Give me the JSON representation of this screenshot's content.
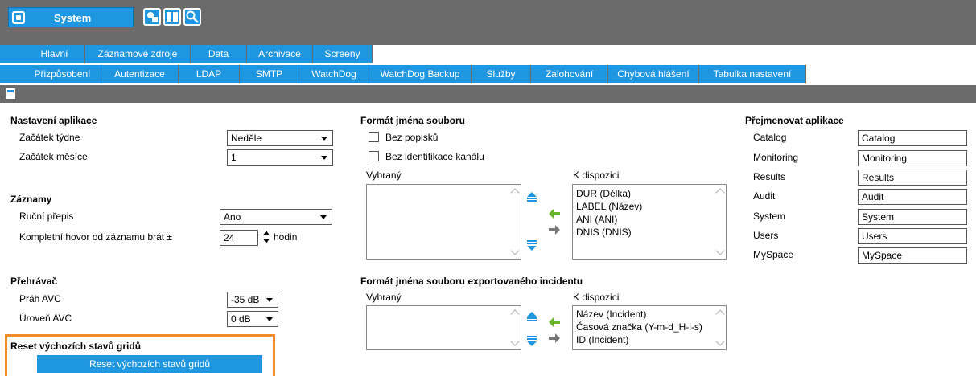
{
  "app": {
    "title": "System"
  },
  "tabs_primary": [
    {
      "label": "Hlavní"
    },
    {
      "label": "Záznamové zdroje"
    },
    {
      "label": "Data"
    },
    {
      "label": "Archivace"
    },
    {
      "label": "Screeny"
    }
  ],
  "tabs_secondary": [
    {
      "label": "Přizpůsobení"
    },
    {
      "label": "Autentizace"
    },
    {
      "label": "LDAP"
    },
    {
      "label": "SMTP"
    },
    {
      "label": "WatchDog"
    },
    {
      "label": "WatchDog Backup"
    },
    {
      "label": "Služby"
    },
    {
      "label": "Zálohování"
    },
    {
      "label": "Chybová hlášení"
    },
    {
      "label": "Tabulka nastavení"
    }
  ],
  "app_settings": {
    "heading": "Nastavení aplikace",
    "week_start_label": "Začátek týdne",
    "week_start_value": "Neděle",
    "month_start_label": "Začátek měsíce",
    "month_start_value": "1"
  },
  "records": {
    "heading": "Záznamy",
    "manual_label": "Ruční přepis",
    "manual_value": "Ano",
    "full_call_label": "Kompletní hovor od záznamu brát ±",
    "full_call_value": "24",
    "full_call_unit": "hodin"
  },
  "player": {
    "heading": "Přehrávač",
    "avc_threshold_label": "Práh AVC",
    "avc_threshold_value": "-35 dB",
    "avc_level_label": "Úroveň AVC",
    "avc_level_value": "0 dB"
  },
  "reset": {
    "heading": "Reset výchozích stavů gridů",
    "button": "Reset výchozích stavů gridů"
  },
  "filename_format": {
    "heading": "Formát jména souboru",
    "no_labels": "Bez popisků",
    "no_channel": "Bez identifikace kanálu",
    "selected_label": "Vybraný",
    "available_label": "K dispozici",
    "available": [
      "DUR (Délka)",
      "LABEL (Název)",
      "ANI (ANI)",
      "DNIS (DNIS)"
    ]
  },
  "incident_format": {
    "heading": "Formát jména souboru exportovaného incidentu",
    "selected_label": "Vybraný",
    "available_label": "K dispozici",
    "available": [
      "Název (Incident)",
      "Časová značka (Y-m-d_H-i-s)",
      "ID (Incident)"
    ]
  },
  "rename_apps": {
    "heading": "Přejmenovat aplikace",
    "rows": [
      {
        "label": "Catalog",
        "value": "Catalog"
      },
      {
        "label": "Monitoring",
        "value": "Monitoring"
      },
      {
        "label": "Results",
        "value": "Results"
      },
      {
        "label": "Audit",
        "value": "Audit"
      },
      {
        "label": "System",
        "value": "System"
      },
      {
        "label": "Users",
        "value": "Users"
      },
      {
        "label": "MySpace",
        "value": "MySpace"
      }
    ]
  },
  "colors": {
    "accent": "#1f96e0",
    "bar": "#6b6b6b",
    "highlight": "#f28c28",
    "green_arrow": "#6ab62a"
  }
}
